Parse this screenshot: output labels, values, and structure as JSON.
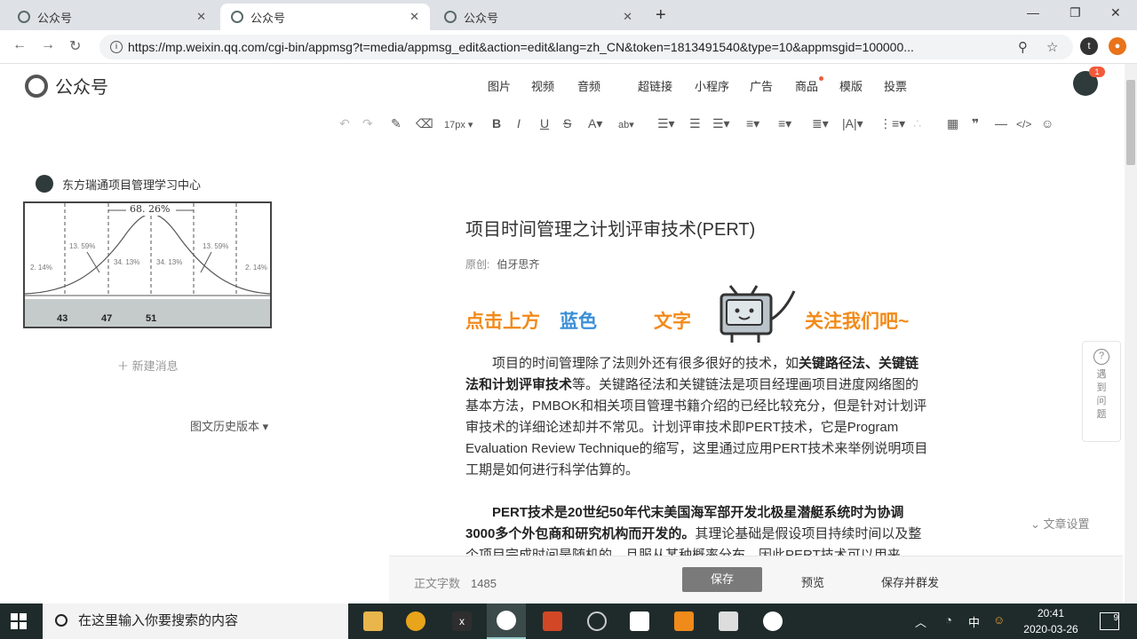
{
  "browser": {
    "tabs": [
      {
        "label": "公众号",
        "active": false
      },
      {
        "label": "公众号",
        "active": true
      },
      {
        "label": "公众号",
        "active": false
      }
    ],
    "url": "https://mp.weixin.qq.com/cgi-bin/appmsg?t=media/appmsg_edit&action=edit&lang=zh_CN&token=1813491540&type=10&appmsgid=100000..."
  },
  "header": {
    "logo": "公众号",
    "menu": [
      "图片",
      "视频",
      "音频",
      "超链接",
      "小程序",
      "广告",
      "商品",
      "模版",
      "投票"
    ],
    "badge": "1"
  },
  "toolbar": {
    "font_size": "17px"
  },
  "left": {
    "account": "东方瑞通项目管理学习中心",
    "thumb": {
      "pct_top": "68. 26%",
      "pct_left_mid": "13. 59%",
      "pct_right_mid": "13. 59%",
      "pct_center_l": "34. 13%",
      "pct_center_r": "34. 13%",
      "pct_left": "2. 14%",
      "pct_right": "2. 14%",
      "axis": [
        "43",
        "47",
        "51"
      ]
    },
    "new_message": "新建消息",
    "history": "图文历史版本"
  },
  "article": {
    "title": "项目时间管理之计划评审技术(PERT)",
    "meta_label": "原创:",
    "author": "伯牙思齐",
    "banner": {
      "left": "点击上方",
      "mid": "蓝色",
      "word": "文字",
      "right": "关注我们吧~"
    },
    "p1_a": "项目的时间管理除了法则外还有很多很好的技术，如",
    "p1_b": "关键路径法、关键链法和计划评审技术",
    "p1_c": "等。关键路径法和关键链法是项目经理画项目进度网络图的基本方法，PMBOK和相关项目管理书籍介绍的已经比较充分，但是针对计划评审技术的详细论述却并不常见。计划评审技术即PERT技术，它是Program Evaluation Review Technique的缩写，这里通过应用PERT技术来举例说明项目工期是如何进行科学估算的。",
    "p2_a": "PERT技术是20世纪50年代末美国海军部开发北极星潜艇系统时为协调3000多个外包商和研究机构而开发的。",
    "p2_b": "其理论基础是假设项目持续时间以及整个项目完成时间是随机的，且服从某种概率分布。因此PERT技术可以用来"
  },
  "side": {
    "help_icon": "question-icon",
    "help_text": "遇到问题",
    "settings": "文章设置"
  },
  "bottom": {
    "wc_label": "正文字数",
    "wc_value": "1485",
    "save": "保存",
    "preview": "预览",
    "publish": "保存并群发"
  },
  "taskbar": {
    "search_placeholder": "在这里输入你要搜索的内容",
    "ime": "中",
    "time": "20:41",
    "date": "2020-03-26",
    "notifications": "9"
  },
  "colors": {
    "banner_orange": "#f28a1a",
    "banner_blue": "#3a8fd8",
    "taskbar": "#1f2b2b",
    "badge_red": "#f25a3a"
  }
}
